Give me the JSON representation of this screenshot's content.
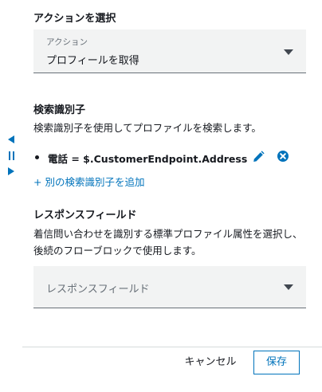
{
  "action_section": {
    "heading": "アクションを選択",
    "select_label": "アクション",
    "select_value": "プロフィールを取得"
  },
  "search_identifier": {
    "heading": "検索識別子",
    "description": "検索識別子を使用してプロファイルを検索します。",
    "items": [
      {
        "text": "電話 = $.CustomerEndpoint.Address"
      }
    ],
    "add_link": "+ 別の検索識別子を追加"
  },
  "response_fields": {
    "heading": "レスポンスフィールド",
    "description": "着信問い合わせを識別する標準プロファイル属性を選択し、後続のフローブロックで使用します。",
    "select_placeholder": "レスポンスフィールド"
  },
  "footer": {
    "cancel_label": "キャンセル",
    "save_label": "保存"
  },
  "colors": {
    "accent": "#0073bb",
    "text": "#16191f",
    "muted": "#687078",
    "field_bg": "#f2f3f3"
  },
  "icons": [
    "collapse-left-icon",
    "drag-handle-icon",
    "expand-right-icon",
    "pencil-icon",
    "remove-circle-icon",
    "caret-down-icon"
  ]
}
